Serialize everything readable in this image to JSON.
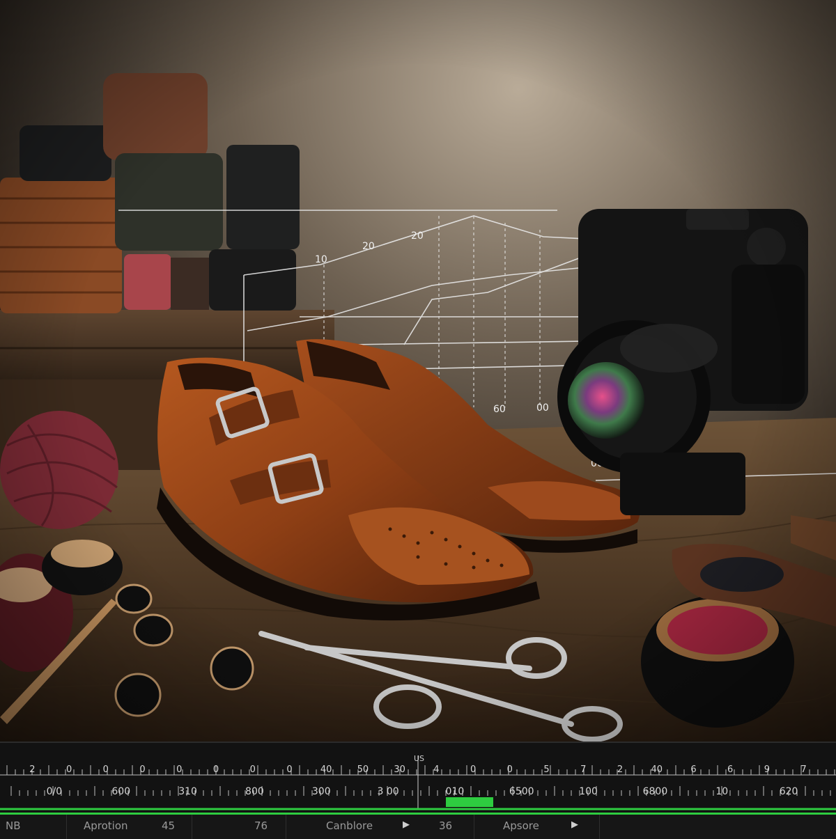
{
  "overlay_graph": {
    "labels": [
      "20",
      "20",
      "10",
      "60",
      "00",
      "00",
      "00"
    ]
  },
  "timeline": {
    "top_marker": "US",
    "top_labels": [
      "2",
      "0",
      "0",
      "0",
      "0",
      "0",
      "0",
      "0",
      "40",
      "50",
      "30",
      "4",
      "0",
      "0",
      "5",
      "7",
      "2",
      "40",
      "6",
      "6",
      "9",
      "7"
    ],
    "bottom_labels": [
      "0/0",
      "600",
      "310",
      "800",
      "300",
      "3 00",
      "010",
      "6500",
      "100",
      "6800",
      "10",
      "620"
    ],
    "highlight_color": "#2ecc40",
    "bottom_bar": [
      {
        "label": "NB"
      },
      {
        "label": "Aprotion"
      },
      {
        "label": "45"
      },
      {
        "label": "76"
      },
      {
        "label": "Canblore"
      },
      {
        "label": "36"
      },
      {
        "label": "Apsore"
      }
    ]
  }
}
